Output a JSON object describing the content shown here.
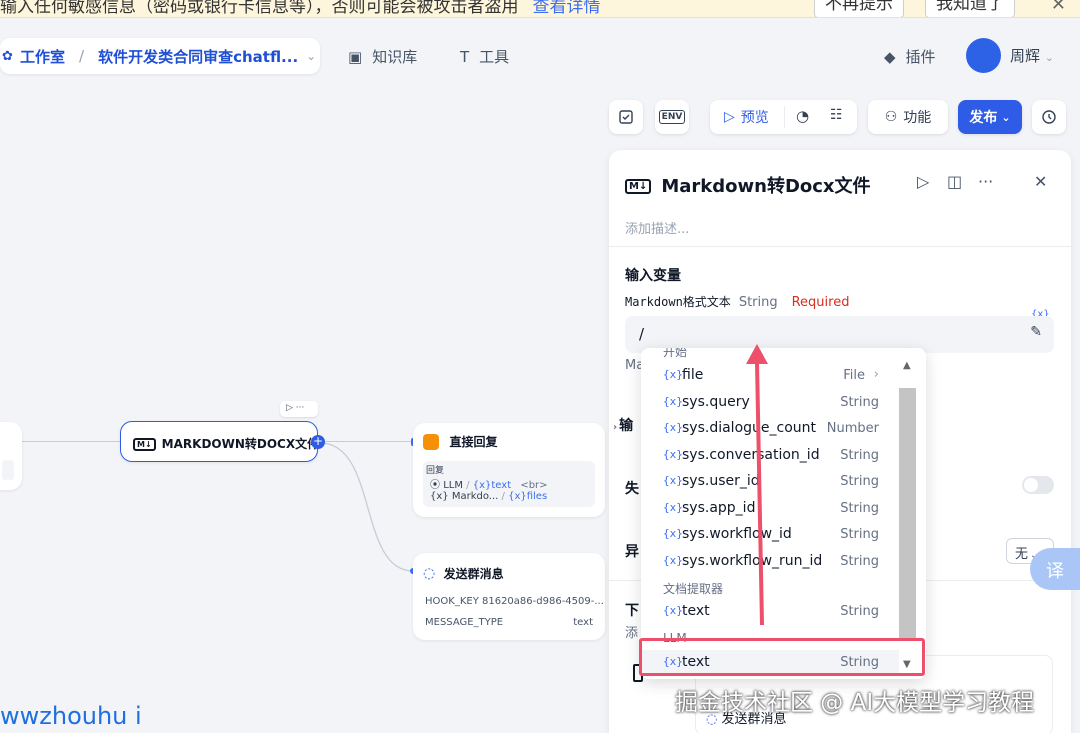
{
  "banner": {
    "text": "输入任何敏感信息（密码或银行卡信息等），否则可能会被攻击者盗用",
    "link": "查看详情",
    "btn_dismiss": "不再提示",
    "btn_ok": "我知道了",
    "close": "✕"
  },
  "topbar": {
    "workspace": "工作室",
    "app_name": "软件开发类合同审查chatfl...",
    "nav_knowledge": "知识库",
    "nav_tools": "工具",
    "plugins": "插件",
    "user": "周辉"
  },
  "toolbar": {
    "env": "ENV",
    "preview": "预览",
    "features": "功能",
    "publish": "发布"
  },
  "canvas": {
    "node_markdown": "MARKDOWN转DOCX文件",
    "node_reply": "直接回复",
    "reply_label": "回复",
    "reply_llm": "LLM",
    "reply_text": "text",
    "reply_br": "<br>",
    "reply_markdown": "Markdo...",
    "reply_files": "files",
    "node_group": "发送群消息",
    "hook_key": "HOOK_KEY 81620a86-d986-4509-...",
    "message_type": "MESSAGE_TYPE",
    "message_type_val": "text"
  },
  "panel": {
    "title": "Markdown转Docx文件",
    "description_placeholder": "添加描述...",
    "section_input": "输入变量",
    "var_name": "Markdown格式文本",
    "var_type": "String",
    "var_required": "Required",
    "input_value": "/",
    "var_hint": "Ma",
    "section_output": "输",
    "section_fail": "失",
    "section_async": "异",
    "select_value": "无",
    "section_next": "下",
    "add_hint": "添",
    "next_node": "发送群消息",
    "x_label": "{x}"
  },
  "dropdown": {
    "group_start": "开始",
    "items": [
      {
        "name": "file",
        "type": "File"
      },
      {
        "name": "sys.query",
        "type": "String"
      },
      {
        "name": "sys.dialogue_count",
        "type": "Number"
      },
      {
        "name": "sys.conversation_id",
        "type": "String"
      },
      {
        "name": "sys.user_id",
        "type": "String"
      },
      {
        "name": "sys.app_id",
        "type": "String"
      },
      {
        "name": "sys.workflow_id",
        "type": "String"
      },
      {
        "name": "sys.workflow_run_id",
        "type": "String"
      }
    ],
    "group_extractor": "文档提取器",
    "extractor_items": [
      {
        "name": "text",
        "type": "String"
      }
    ],
    "group_llm": "LLM",
    "llm_items": [
      {
        "name": "text",
        "type": "String"
      }
    ],
    "var_icon": "{x}"
  },
  "watermark": {
    "left": "wwzhouhu i",
    "right": "掘金技术社区 @ AI大模型学习教程"
  },
  "translate": "译",
  "colors": {
    "accent": "#2e5ce6",
    "highlight": "#ee4f6a",
    "banner_bg": "#fef6dc"
  }
}
